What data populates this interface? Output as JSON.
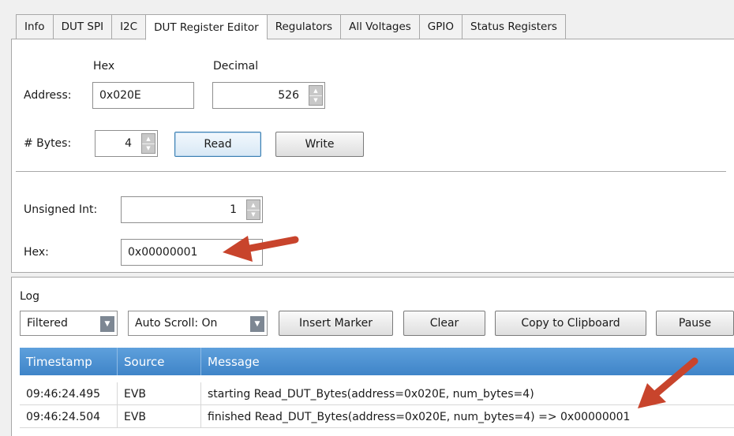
{
  "tabs": [
    "Info",
    "DUT SPI",
    "I2C",
    "DUT Register Editor",
    "Regulators",
    "All Voltages",
    "GPIO",
    "Status Registers"
  ],
  "active_tab": "DUT Register Editor",
  "editor": {
    "hex_header": "Hex",
    "decimal_header": "Decimal",
    "address_label": "Address:",
    "address_hex": "0x020E",
    "address_decimal": "526",
    "bytes_label": "# Bytes:",
    "bytes_value": "4",
    "read_label": "Read",
    "write_label": "Write",
    "uint_label": "Unsigned Int:",
    "uint_value": "1",
    "hex_label": "Hex:",
    "hex_value": "0x00000001"
  },
  "log": {
    "title": "Log",
    "filter_value": "Filtered",
    "autoscroll_value": "Auto Scroll: On",
    "insert_marker_label": "Insert Marker",
    "clear_label": "Clear",
    "copy_label": "Copy to Clipboard",
    "pause_label": "Pause",
    "columns": [
      "Timestamp",
      "Source",
      "Message"
    ],
    "rows": [
      {
        "timestamp": "09:46:24.495",
        "source": "EVB",
        "message": "starting Read_DUT_Bytes(address=0x020E, num_bytes=4)"
      },
      {
        "timestamp": "09:46:24.504",
        "source": "EVB",
        "message": "finished Read_DUT_Bytes(address=0x020E, num_bytes=4) => 0x00000001"
      }
    ]
  },
  "colors": {
    "header_blue": "#4a8fd2",
    "annotation_arrow": "#c8442c"
  }
}
